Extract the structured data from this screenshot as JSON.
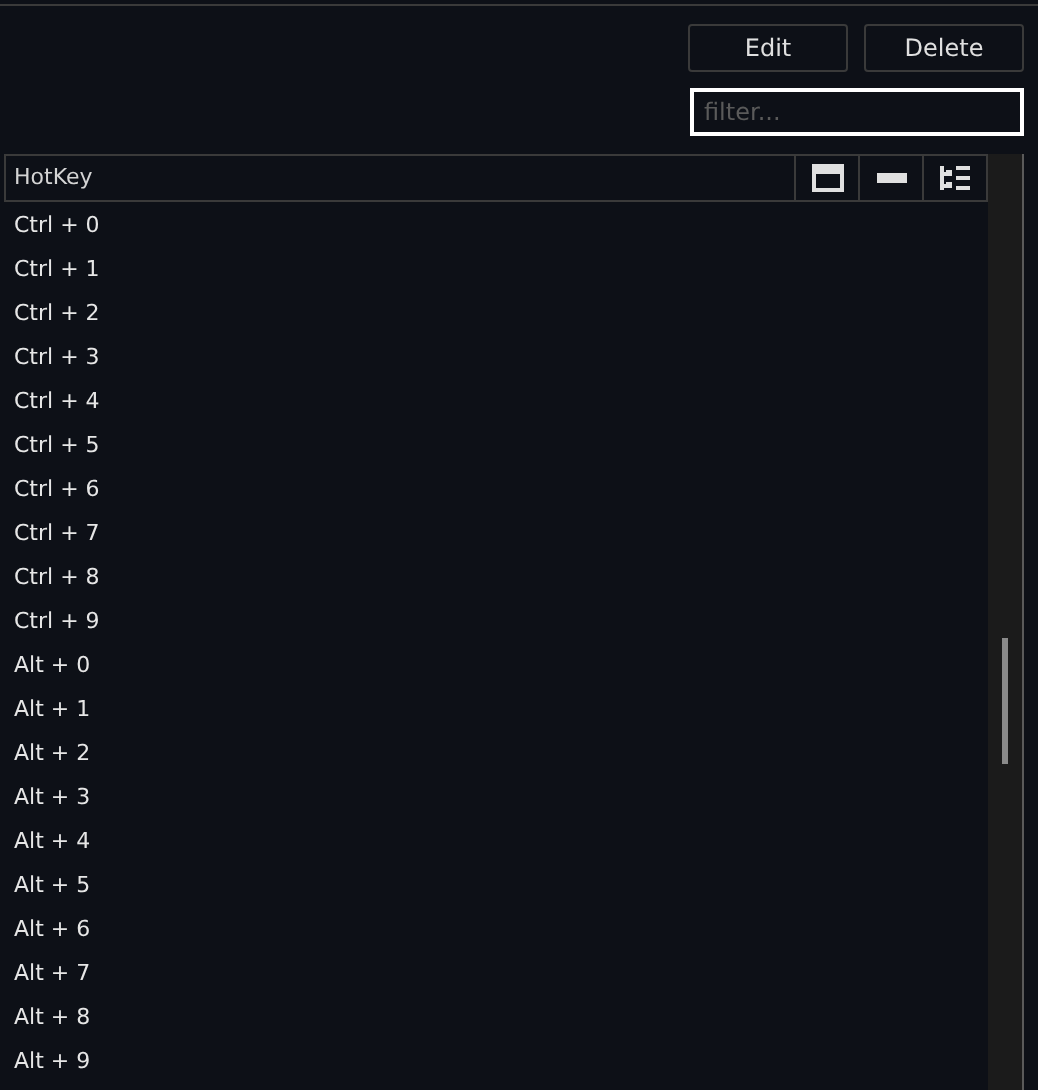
{
  "toolbar": {
    "buttons": [
      "Edit",
      "Delete"
    ]
  },
  "filter": {
    "placeholder": "filter..."
  },
  "table": {
    "columns": [
      "HotKey"
    ],
    "rows": [
      "Ctrl + 0",
      "Ctrl + 1",
      "Ctrl + 2",
      "Ctrl + 3",
      "Ctrl + 4",
      "Ctrl + 5",
      "Ctrl + 6",
      "Ctrl + 7",
      "Ctrl + 8",
      "Ctrl + 9",
      "Alt + 0",
      "Alt + 1",
      "Alt + 2",
      "Alt + 3",
      "Alt + 4",
      "Alt + 5",
      "Alt + 6",
      "Alt + 7",
      "Alt + 8",
      "Alt + 9"
    ]
  }
}
